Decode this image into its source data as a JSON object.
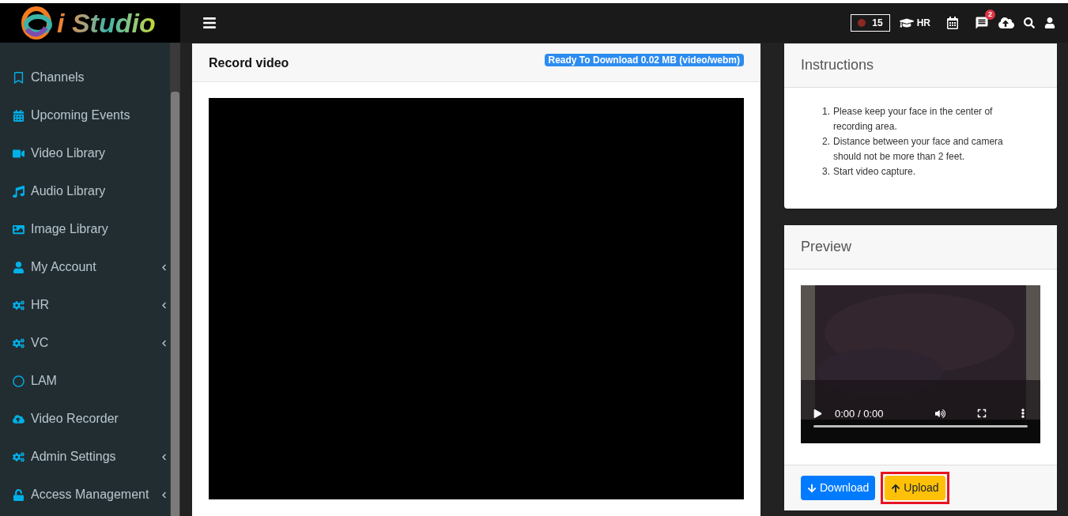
{
  "logo": {
    "text": "i Studio"
  },
  "sidebar": {
    "items": [
      {
        "label": "Channels",
        "expandable": false
      },
      {
        "label": "Upcoming Events",
        "expandable": false
      },
      {
        "label": "Video Library",
        "expandable": false
      },
      {
        "label": "Audio Library",
        "expandable": false
      },
      {
        "label": "Image Library",
        "expandable": false
      },
      {
        "label": "My Account",
        "expandable": true
      },
      {
        "label": "HR",
        "expandable": true
      },
      {
        "label": "VC",
        "expandable": true
      },
      {
        "label": "LAM",
        "expandable": false
      },
      {
        "label": "Video Recorder",
        "expandable": false
      },
      {
        "label": "Admin Settings",
        "expandable": true
      },
      {
        "label": "Access Management",
        "expandable": true
      }
    ]
  },
  "header": {
    "record_count": "15",
    "hr_label": "HR",
    "messages_badge": "2"
  },
  "record_card": {
    "title": "Record video",
    "status_badge": "Ready To Download 0.02 MB (video/webm)"
  },
  "instructions": {
    "title": "Instructions",
    "steps": [
      {
        "marker": "1.",
        "text": "Please keep your face in the center of recording area."
      },
      {
        "marker": "2.",
        "text": "Distance between your face and camera should not be more than 2 feet."
      },
      {
        "marker": "3.",
        "text": "Start video capture."
      }
    ]
  },
  "preview": {
    "title": "Preview",
    "time": "0:00 / 0:00",
    "buttons": [
      {
        "label": "Download",
        "kind": "primary",
        "highlighted": false
      },
      {
        "label": "Upload",
        "kind": "warning",
        "highlighted": true
      }
    ]
  }
}
